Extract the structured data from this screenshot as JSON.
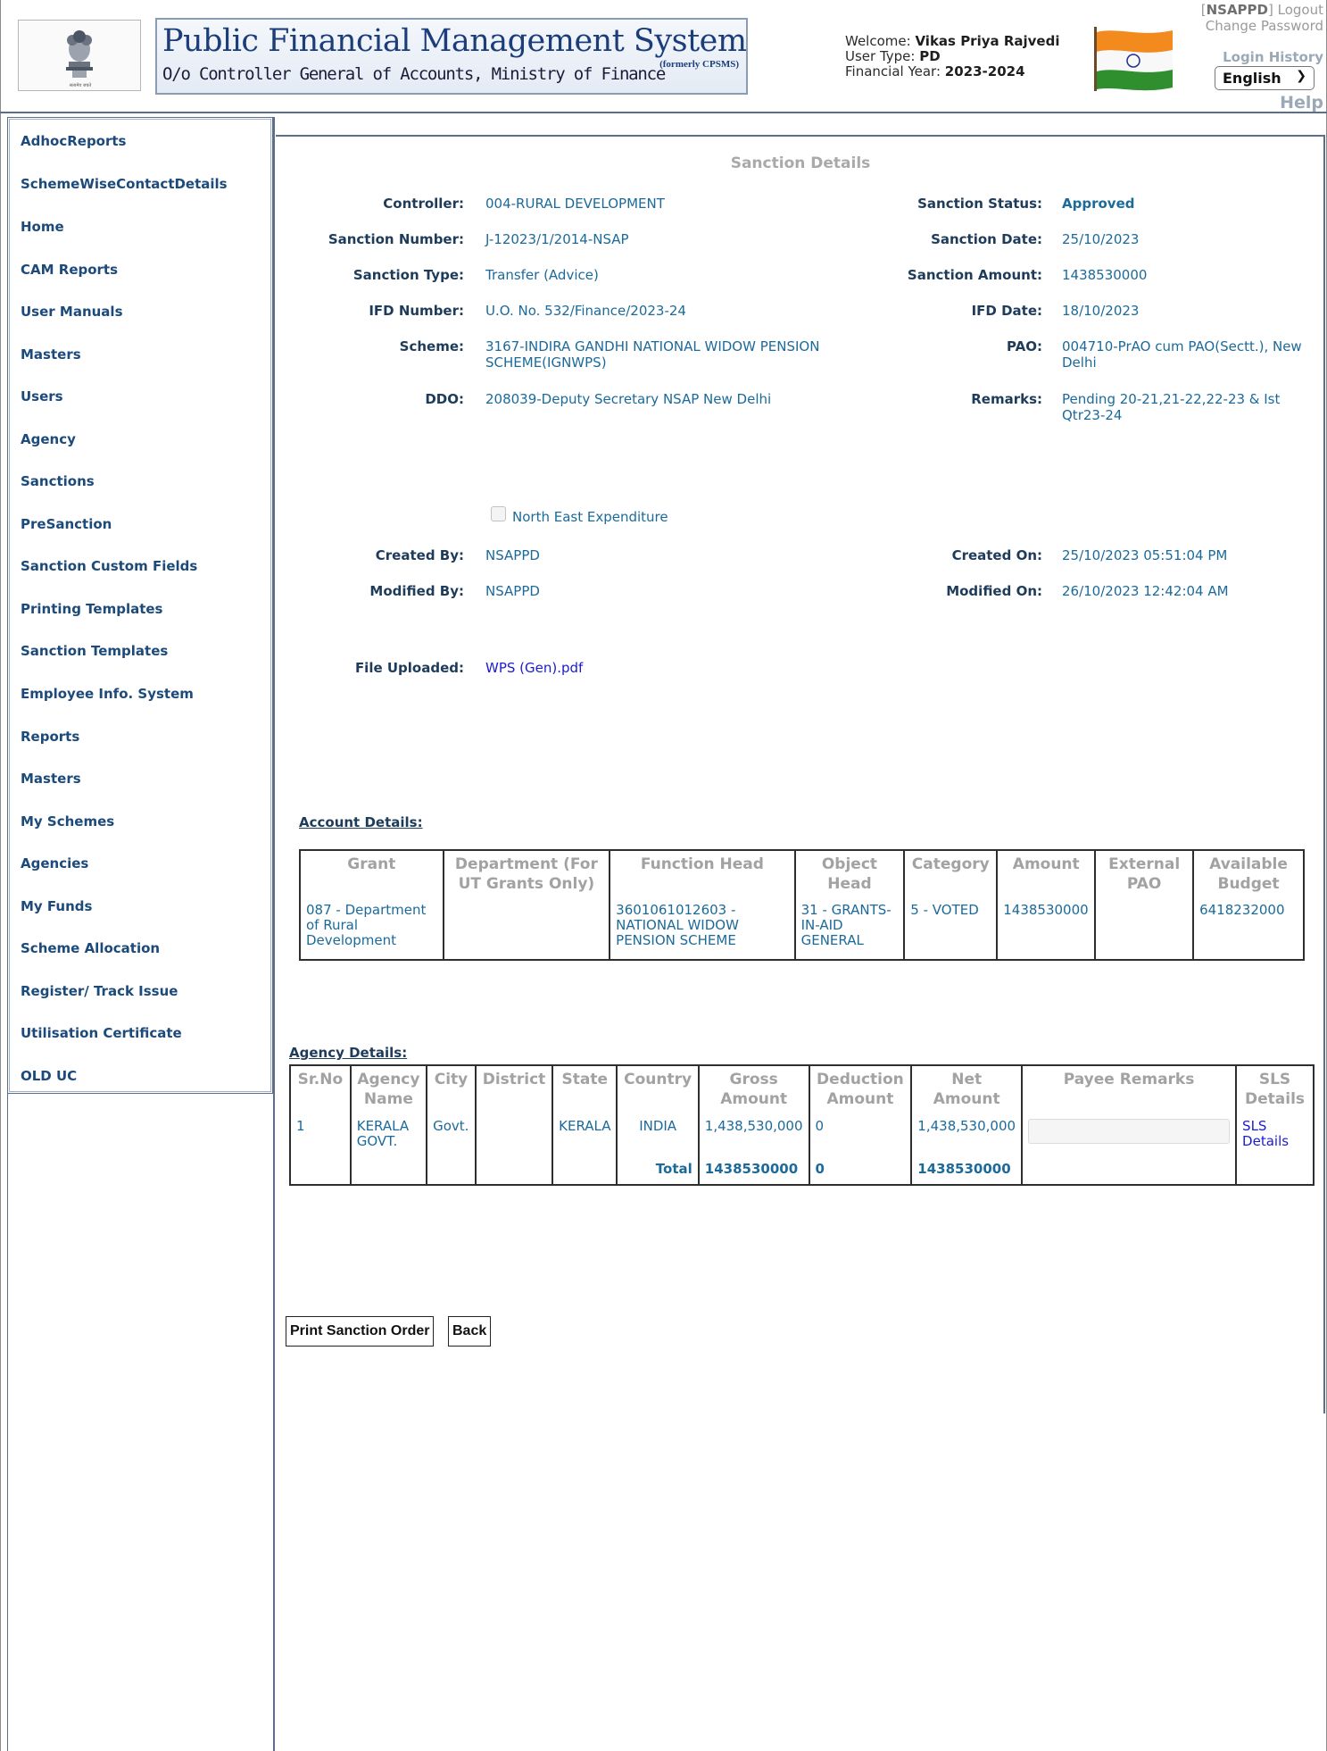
{
  "header": {
    "banner_title": "Public Financial Management System-PFMS",
    "banner_formerly": "(formerly CPSMS)",
    "banner_subtitle": "O/o Controller General of Accounts, Ministry of Finance",
    "emblem_caption": "सत्यमेव जयते",
    "welcome_label": "Welcome:",
    "welcome_name": "Vikas Priya Rajvedi",
    "user_type_label": "User Type:",
    "user_type": "PD",
    "fy_label": "Financial Year:",
    "fy_value": "2023-2024",
    "username_open": "[",
    "username": "NSAPPD",
    "username_close": "]",
    "logout": "Logout",
    "change_password": "Change Password",
    "login_history": "Login History",
    "language": "English",
    "help": "Help",
    "colors": {
      "banner_text": "#1b3d7a",
      "border": "#5c6f8a",
      "muted": "#9aa9b5"
    }
  },
  "sidebar": {
    "items": [
      "AdhocReports",
      "SchemeWiseContactDetails",
      "Home",
      "CAM Reports",
      "User Manuals",
      "Masters",
      "Users",
      "Agency",
      "Sanctions",
      "PreSanction",
      "Sanction Custom Fields",
      "Printing Templates",
      "Sanction Templates",
      "Employee Info. System",
      "Reports",
      "Masters",
      "My Schemes",
      "Agencies",
      "My Funds",
      "Scheme Allocation",
      "Register/ Track Issue",
      "Utilisation Certificate",
      "OLD UC"
    ],
    "colors": {
      "link": "#1c4a7a"
    }
  },
  "sanction": {
    "title": "Sanction Details",
    "controller_label": "Controller:",
    "controller": "004-RURAL DEVELOPMENT",
    "status_label": "Sanction Status:",
    "status": "Approved",
    "number_label": "Sanction Number:",
    "number": "J-12023/1/2014-NSAP",
    "date_label": "Sanction Date:",
    "date": "25/10/2023",
    "type_label": "Sanction Type:",
    "type": "Transfer (Advice)",
    "amount_label": "Sanction Amount:",
    "amount": "1438530000",
    "ifd_number_label": "IFD Number:",
    "ifd_number": "U.O. No. 532/Finance/2023-24",
    "ifd_date_label": "IFD Date:",
    "ifd_date": "18/10/2023",
    "scheme_label": "Scheme:",
    "scheme": "3167-INDIRA GANDHI NATIONAL WIDOW PENSION SCHEME(IGNWPS)",
    "pao_label": "PAO:",
    "pao": "004710-PrAO cum PAO(Sectt.), New Delhi",
    "ddo_label": "DDO:",
    "ddo": "208039-Deputy Secretary NSAP New Delhi",
    "remarks_label": "Remarks:",
    "remarks": "Pending 20-21,21-22,22-23 & Ist Qtr23-24",
    "north_east_label": "North East Expenditure",
    "north_east_checked": false,
    "created_by_label": "Created By:",
    "created_by": "NSAPPD",
    "created_on_label": "Created On:",
    "created_on": "25/10/2023 05:51:04 PM",
    "modified_by_label": "Modified By:",
    "modified_by": "NSAPPD",
    "modified_on_label": "Modified On:",
    "modified_on": "26/10/2023 12:42:04 AM",
    "file_label": "File Uploaded:",
    "file_name": "WPS (Gen).pdf"
  },
  "account": {
    "title": "Account Details:",
    "headers": [
      "Grant",
      "Department (For UT Grants Only)",
      "Function Head",
      "Object Head",
      "Category",
      "Amount",
      "External PAO",
      "Available Budget"
    ],
    "rows": [
      [
        "087 - Department of Rural Development",
        "",
        "3601061012603 - NATIONAL WIDOW PENSION SCHEME",
        "31 - GRANTS-IN-AID GENERAL",
        "5 - VOTED",
        "1438530000",
        "",
        "6418232000"
      ]
    ]
  },
  "agency": {
    "title": "Agency Details:",
    "headers": [
      "Sr.No",
      "Agency Name",
      "City",
      "District",
      "State",
      "Country",
      "Gross Amount",
      "Deduction Amount",
      "Net Amount",
      "Payee Remarks",
      "SLS Details"
    ],
    "rows": [
      [
        "1",
        "KERALA GOVT.",
        "Govt.",
        "",
        "KERALA",
        "INDIA",
        "1,438,530,000",
        "0",
        "1,438,530,000",
        "",
        "SLS Details"
      ]
    ],
    "total_label": "Total",
    "total_gross": "1438530000",
    "total_deduction": "0",
    "total_net": "1438530000"
  },
  "buttons": {
    "print": "Print Sanction Order",
    "back": "Back"
  }
}
